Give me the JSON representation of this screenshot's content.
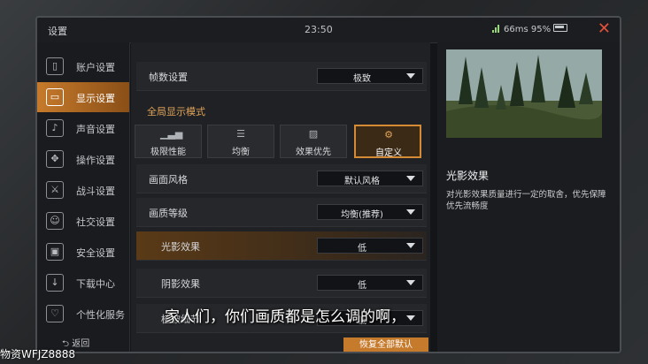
{
  "topbar": {
    "title": "设置",
    "time": "23:50",
    "ping": "66ms",
    "battery": "95%"
  },
  "sidebar": {
    "items": [
      {
        "label": "账户设置",
        "icon": "account-icon"
      },
      {
        "label": "显示设置",
        "icon": "display-icon"
      },
      {
        "label": "声音设置",
        "icon": "sound-icon"
      },
      {
        "label": "操作设置",
        "icon": "control-icon"
      },
      {
        "label": "战斗设置",
        "icon": "combat-icon"
      },
      {
        "label": "社交设置",
        "icon": "social-icon"
      },
      {
        "label": "安全设置",
        "icon": "lock-icon"
      },
      {
        "label": "下载中心",
        "icon": "download-icon"
      },
      {
        "label": "个性化服务",
        "icon": "personalize-icon"
      }
    ],
    "back_label": "返回"
  },
  "main": {
    "frame_rate": {
      "label": "帧数设置",
      "value": "极致"
    },
    "section_title": "全局显示模式",
    "presets": [
      {
        "label": "极限性能",
        "icon": "performance-icon"
      },
      {
        "label": "均衡",
        "icon": "sliders-icon"
      },
      {
        "label": "效果优先",
        "icon": "image-icon"
      },
      {
        "label": "自定义",
        "icon": "gears-icon"
      }
    ],
    "style": {
      "label": "画面风格",
      "value": "默认风格"
    },
    "quality": {
      "label": "画质等级",
      "value": "均衡(推荐)"
    },
    "lighting": {
      "label": "光影效果",
      "value": "低"
    },
    "shadow": {
      "label": "阴影效果",
      "value": "低"
    },
    "vegetation": {
      "label": "植被细节",
      "value": "低"
    },
    "restore_label": "恢复全部默认"
  },
  "detail": {
    "title": "光影效果",
    "description": "对光影效果质量进行一定的取舍，优先保障优先流畅度"
  },
  "overlay": {
    "subtitle": "家人们，你们画质都是怎么调的啊，",
    "watermark": "物资WFJZ8888"
  },
  "colors": {
    "accent": "#c67a2b",
    "close": "#e2513b",
    "section": "#e0a45a"
  }
}
